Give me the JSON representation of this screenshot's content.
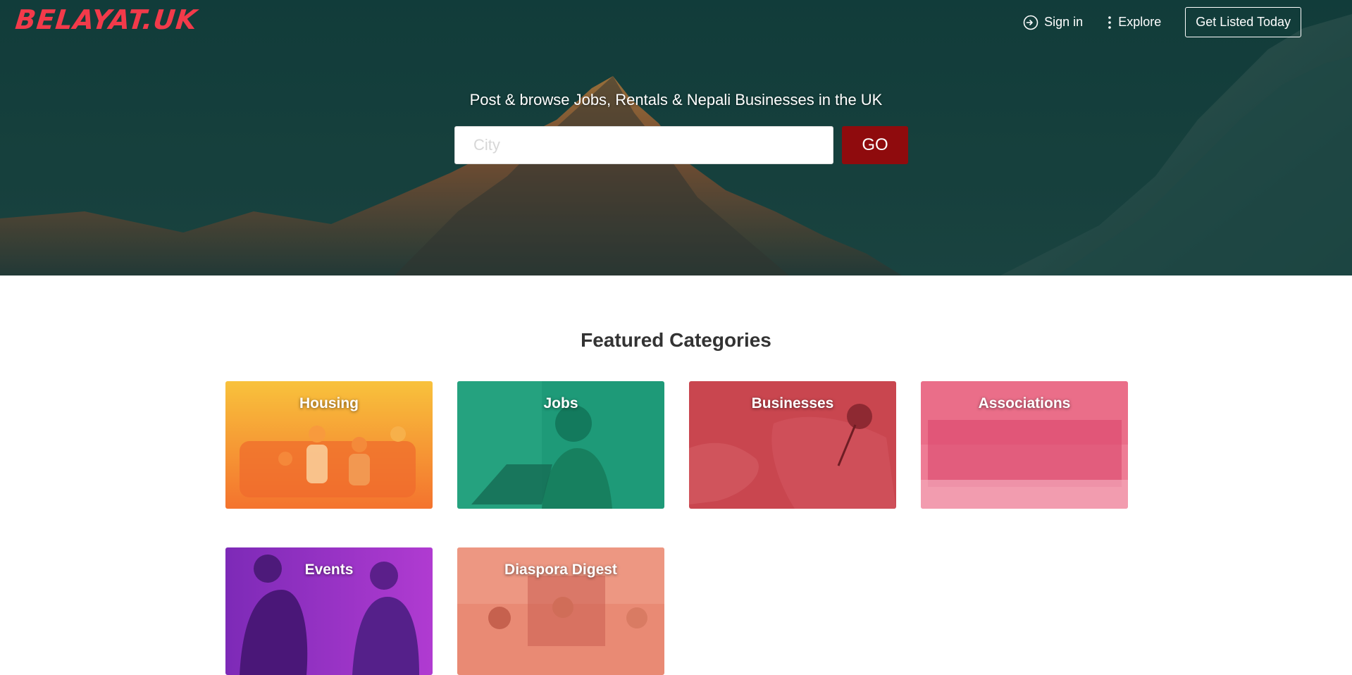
{
  "header": {
    "logo": "BELAYAT.UK",
    "nav": {
      "signin_label": "Sign in",
      "explore_label": "Explore",
      "cta_label": "Get Listed Today"
    }
  },
  "hero": {
    "tagline": "Post & browse Jobs, Rentals & Nepali Businesses in the UK",
    "search": {
      "placeholder": "City",
      "value": "",
      "button_label": "GO"
    }
  },
  "featured": {
    "title": "Featured Categories",
    "cards": [
      {
        "label": "Housing",
        "color": "#f5a33e"
      },
      {
        "label": "Jobs",
        "color": "#1f9a78"
      },
      {
        "label": "Businesses",
        "color": "#c9464f"
      },
      {
        "label": "Associations",
        "color": "#e8607f"
      },
      {
        "label": "Events",
        "color": "#8d2fbf"
      },
      {
        "label": "Diaspora Digest",
        "color": "#e97a6a"
      }
    ]
  },
  "colors": {
    "brand": "#f23a4a",
    "go_button": "#8f0b0d",
    "hero_bg": "#17433f"
  }
}
